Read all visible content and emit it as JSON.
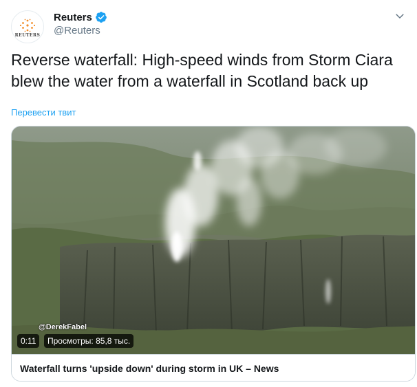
{
  "author": {
    "display_name": "Reuters",
    "handle": "@Reuters",
    "avatar_text": "REUTERS",
    "verified": true
  },
  "tweet": {
    "text": "Reverse waterfall: High-speed winds from Storm Ciara blew the water from a waterfall in Scotland back up",
    "translate_label": "Перевести твит"
  },
  "media_card": {
    "credit": "@DerekFabel",
    "duration": "0:11",
    "views": "Просмотры: 85,8 тыс.",
    "title": "Waterfall turns 'upside down' during storm in UK – News"
  },
  "colors": {
    "link": "#1da1f2",
    "verified_badge": "#1da1f2",
    "secondary_text": "#657786",
    "border": "#ccd6dd"
  },
  "icons": {
    "verified": "verified-badge-icon",
    "menu": "chevron-down-icon"
  }
}
